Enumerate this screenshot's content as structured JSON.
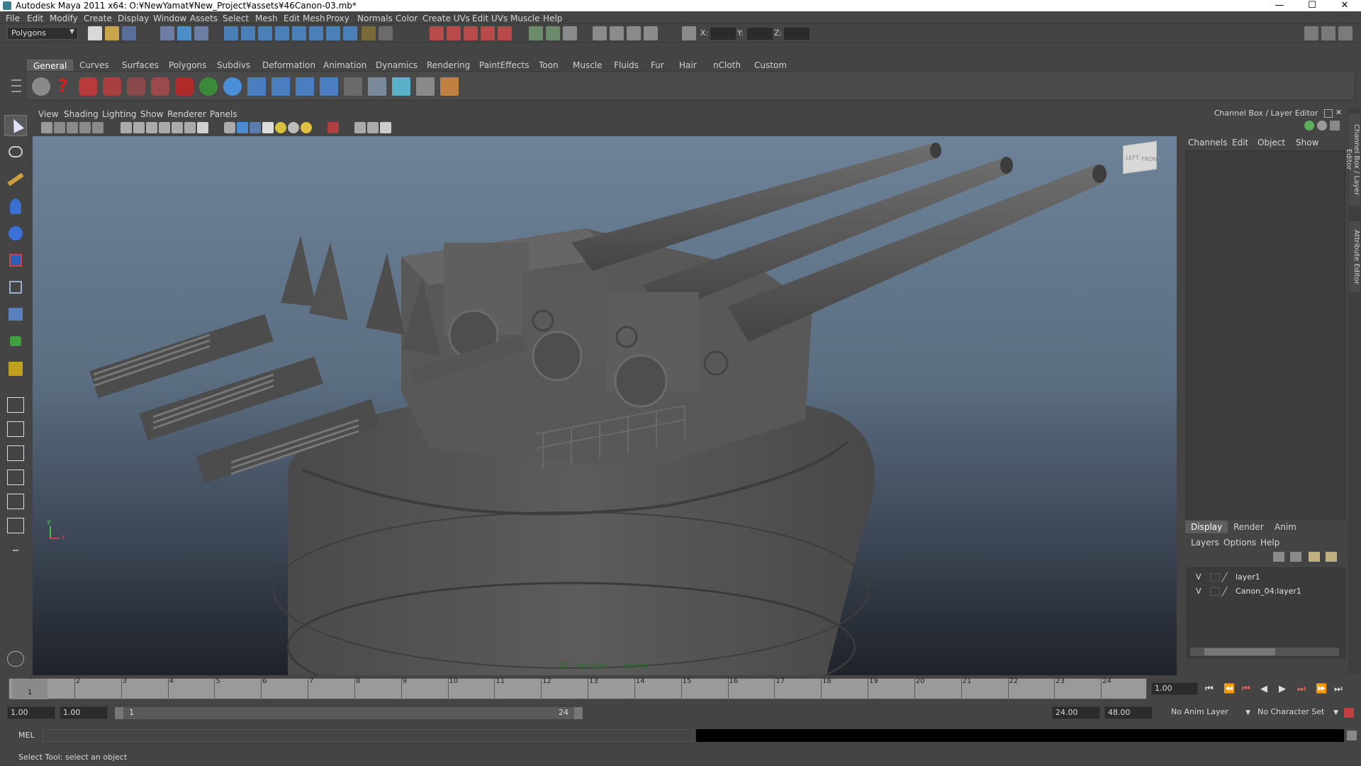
{
  "window": {
    "title": "Autodesk Maya 2011 x64: O:¥NewYamat¥New_Project¥assets¥46Canon-03.mb*",
    "minimize_glyph": "—",
    "maximize_glyph": "☐",
    "close_glyph": "✕"
  },
  "menubar": [
    "File",
    "Edit",
    "Modify",
    "Create",
    "Display",
    "Window",
    "Assets",
    "Select",
    "Mesh",
    "Edit Mesh",
    "Proxy",
    "Normals",
    "Color",
    "Create UVs",
    "Edit UVs",
    "Muscle",
    "Help"
  ],
  "statusline": {
    "mode": "Polygons",
    "x_label": "X:",
    "y_label": "Y:",
    "z_label": "Z:"
  },
  "shelf": {
    "tabs": [
      "General",
      "Curves",
      "Surfaces",
      "Polygons",
      "Subdivs",
      "Deformation",
      "Animation",
      "Dynamics",
      "Rendering",
      "PaintEffects",
      "Toon",
      "Muscle",
      "Fluids",
      "Fur",
      "Hair",
      "nCloth",
      "Custom"
    ],
    "active_tab": "General"
  },
  "viewport": {
    "menu": [
      "View",
      "Shading",
      "Lighting",
      "Show",
      "Renderer",
      "Panels"
    ],
    "camera_label": "2D Pan/Zoom : persp",
    "viewcube_left": "LEFT",
    "viewcube_front": "FRONT",
    "axis_y": "y",
    "axis_x": "x",
    "colors": {
      "bg_top": "#6d8298",
      "bg_bottom": "#1e2229",
      "model": "#5a5a5a"
    }
  },
  "channelbox": {
    "title": "Channel Box / Layer Editor",
    "menu": [
      "Channels",
      "Edit",
      "Object",
      "Show"
    ],
    "layer_tabs": [
      "Display",
      "Render",
      "Anim"
    ],
    "active_layer_tab": "Display",
    "layer_menu": [
      "Layers",
      "Options",
      "Help"
    ],
    "layers": [
      {
        "visible": "V",
        "name": "layer1"
      },
      {
        "visible": "V",
        "name": "Canon_04:layer1"
      }
    ]
  },
  "side_tabs": [
    "Channel Box / Layer Editor",
    "Attribute Editor"
  ],
  "timeslider": {
    "ticks": [
      "1",
      "2",
      "3",
      "4",
      "5",
      "6",
      "7",
      "8",
      "9",
      "10",
      "11",
      "12",
      "13",
      "14",
      "15",
      "16",
      "17",
      "18",
      "19",
      "20",
      "21",
      "22",
      "23",
      "24"
    ],
    "current_frame_marker": "1",
    "current_time": "1.00"
  },
  "range": {
    "start_time": "1.00",
    "playback_start": "1.00",
    "range_start_label": "1",
    "range_end_label": "24",
    "playback_end": "24.00",
    "end_time": "48.00",
    "anim_layer": "No Anim Layer",
    "character_set": "No Character Set"
  },
  "commandline": {
    "label": "MEL"
  },
  "helpline": {
    "text": "Select Tool: select an object"
  }
}
